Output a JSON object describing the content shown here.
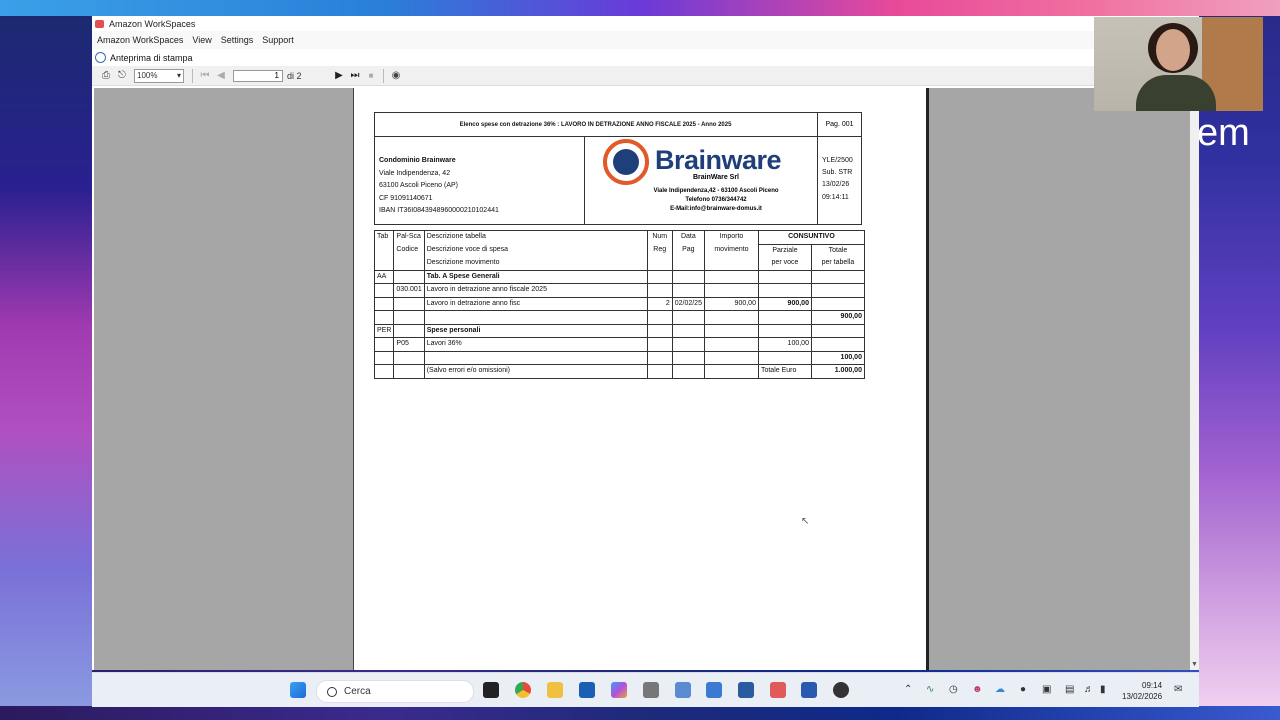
{
  "window": {
    "title": "Amazon WorkSpaces"
  },
  "menu": [
    "Amazon WorkSpaces",
    "View",
    "Settings",
    "Support"
  ],
  "preview": {
    "title": "Anteprima di stampa"
  },
  "toolbar": {
    "zoom": "100%",
    "page": "1",
    "of_pages": "di 2"
  },
  "doc": {
    "title": "Elenco spese con detrazione 36% : LAVORO IN DETRAZIONE ANNO FISCALE 2025 - Anno 2025",
    "page": "Pag. 001",
    "condo_name": "Condominio Brainware",
    "condo_addr1": "Viale Indipendenza, 42",
    "condo_addr2": "63100 Ascoli Piceno (AP)",
    "condo_cf": "CF 91091140671",
    "condo_iban": "IBAN IT36I0843948960000210102441",
    "brand": "Brainware",
    "brand_sub": "BrainWare Srl",
    "brand_addr": "Viale Indipendenza,42 - 63100 Ascoli Piceno",
    "brand_tel": "Telefono 0736/344742",
    "brand_mail": "E-Mail:info@brainware-domus.it",
    "ref_code": "YLE/2500",
    "ref_sub": "Sub. STR",
    "ref_date": "13/02/26",
    "ref_time": "09:14:11"
  },
  "table": {
    "h": {
      "tab": "Tab",
      "palsca": "Pal-Sca",
      "codice": "Codice",
      "desc1": "Descrizione tabella",
      "desc2": "Descrizione voce di spesa",
      "desc3": "Descrizione movimento",
      "num": "Num",
      "reg": "Reg",
      "data": "Data",
      "pag": "Pag",
      "imp1": "Importo",
      "imp2": "movimento",
      "consuntivo": "CONSUNTIVO",
      "parz1": "Parziale",
      "parz2": "per voce",
      "tot1": "Totale",
      "tot2": "per tabella"
    },
    "r1": {
      "tab": "AA",
      "desc": "Tab. A Spese Generali"
    },
    "r2": {
      "code": "030.001",
      "desc": "Lavoro in detrazione anno fiscale 2025"
    },
    "r3": {
      "desc": "Lavoro in detrazione anno fisc",
      "num": "2",
      "data": "02/02/25",
      "imp": "900,00",
      "parz": "900,00"
    },
    "r4": {
      "tot": "900,00"
    },
    "r5": {
      "tab": "PER",
      "desc": "Spese personali"
    },
    "r6": {
      "code": "P05",
      "desc": "Lavori 36%",
      "parz": "100,00"
    },
    "r7": {
      "tot": "100,00"
    },
    "r8": {
      "desc": "(Salvo errori e/o omissioni)",
      "label": "Totale Euro",
      "tot": "1.000,00"
    }
  },
  "taskbar": {
    "search": "Cerca",
    "time": "09:14",
    "date": "13/02/2026"
  },
  "overlay_text": "em"
}
